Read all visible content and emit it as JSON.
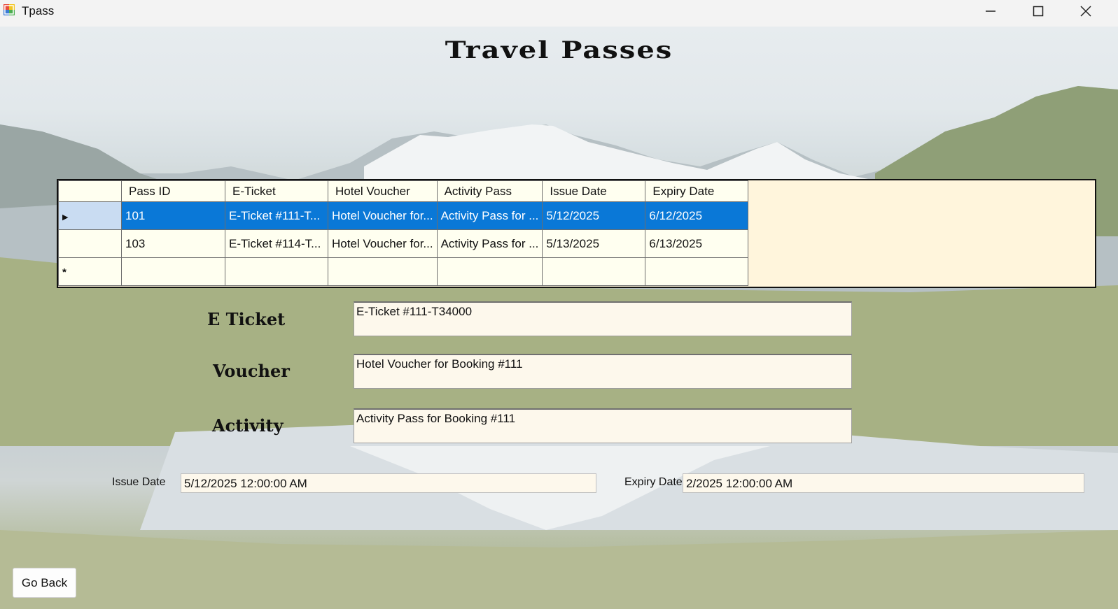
{
  "window": {
    "title": "Tpass",
    "controls": {
      "minimize": "—",
      "maximize": "☐",
      "close": "✕"
    }
  },
  "page_title": "Travel Passes",
  "grid": {
    "columns": [
      "Pass ID",
      "E-Ticket",
      "Hotel Voucher",
      "Activity Pass",
      "Issue Date",
      "Expiry Date"
    ],
    "rows": [
      {
        "pass_id": "101",
        "eticket": "E-Ticket #111-T...",
        "hotel_voucher": "Hotel Voucher for...",
        "activity_pass": "Activity Pass for ...",
        "issue_date": "5/12/2025",
        "expiry_date": "6/12/2025",
        "selected": true,
        "marker": "▶"
      },
      {
        "pass_id": "103",
        "eticket": "E-Ticket #114-T...",
        "hotel_voucher": "Hotel Voucher for...",
        "activity_pass": "Activity Pass for ...",
        "issue_date": "5/13/2025",
        "expiry_date": "6/13/2025",
        "selected": false,
        "marker": ""
      }
    ],
    "new_row_marker": "*"
  },
  "form": {
    "eticket_label": "E Ticket",
    "eticket_value": "E-Ticket #111-T34000",
    "voucher_label": "Voucher",
    "voucher_value": "Hotel Voucher for Booking #111",
    "activity_label": "Activity",
    "activity_value": "Activity Pass for Booking #111",
    "issue_date_label": "Issue Date",
    "issue_date_value": "5/12/2025 12:00:00 AM",
    "expiry_date_label": "Expiry Date",
    "expiry_date_value": "2/2025 12:00:00 AM"
  },
  "go_back_label": "Go Back",
  "colors": {
    "selection": "#0a78d7",
    "grid_background": "#fff5dc",
    "cell_background": "#fffff0"
  }
}
